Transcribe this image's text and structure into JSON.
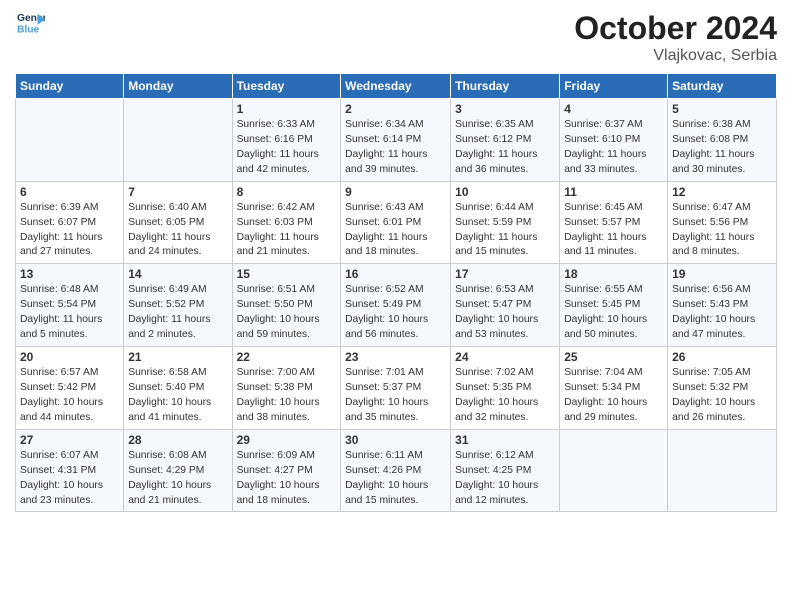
{
  "header": {
    "logo_line1": "General",
    "logo_line2": "Blue",
    "month_title": "October 2024",
    "location": "Vlajkovac, Serbia"
  },
  "weekdays": [
    "Sunday",
    "Monday",
    "Tuesday",
    "Wednesday",
    "Thursday",
    "Friday",
    "Saturday"
  ],
  "weeks": [
    [
      {
        "day": "",
        "sunrise": "",
        "sunset": "",
        "daylight": ""
      },
      {
        "day": "",
        "sunrise": "",
        "sunset": "",
        "daylight": ""
      },
      {
        "day": "1",
        "sunrise": "Sunrise: 6:33 AM",
        "sunset": "Sunset: 6:16 PM",
        "daylight": "Daylight: 11 hours and 42 minutes."
      },
      {
        "day": "2",
        "sunrise": "Sunrise: 6:34 AM",
        "sunset": "Sunset: 6:14 PM",
        "daylight": "Daylight: 11 hours and 39 minutes."
      },
      {
        "day": "3",
        "sunrise": "Sunrise: 6:35 AM",
        "sunset": "Sunset: 6:12 PM",
        "daylight": "Daylight: 11 hours and 36 minutes."
      },
      {
        "day": "4",
        "sunrise": "Sunrise: 6:37 AM",
        "sunset": "Sunset: 6:10 PM",
        "daylight": "Daylight: 11 hours and 33 minutes."
      },
      {
        "day": "5",
        "sunrise": "Sunrise: 6:38 AM",
        "sunset": "Sunset: 6:08 PM",
        "daylight": "Daylight: 11 hours and 30 minutes."
      }
    ],
    [
      {
        "day": "6",
        "sunrise": "Sunrise: 6:39 AM",
        "sunset": "Sunset: 6:07 PM",
        "daylight": "Daylight: 11 hours and 27 minutes."
      },
      {
        "day": "7",
        "sunrise": "Sunrise: 6:40 AM",
        "sunset": "Sunset: 6:05 PM",
        "daylight": "Daylight: 11 hours and 24 minutes."
      },
      {
        "day": "8",
        "sunrise": "Sunrise: 6:42 AM",
        "sunset": "Sunset: 6:03 PM",
        "daylight": "Daylight: 11 hours and 21 minutes."
      },
      {
        "day": "9",
        "sunrise": "Sunrise: 6:43 AM",
        "sunset": "Sunset: 6:01 PM",
        "daylight": "Daylight: 11 hours and 18 minutes."
      },
      {
        "day": "10",
        "sunrise": "Sunrise: 6:44 AM",
        "sunset": "Sunset: 5:59 PM",
        "daylight": "Daylight: 11 hours and 15 minutes."
      },
      {
        "day": "11",
        "sunrise": "Sunrise: 6:45 AM",
        "sunset": "Sunset: 5:57 PM",
        "daylight": "Daylight: 11 hours and 11 minutes."
      },
      {
        "day": "12",
        "sunrise": "Sunrise: 6:47 AM",
        "sunset": "Sunset: 5:56 PM",
        "daylight": "Daylight: 11 hours and 8 minutes."
      }
    ],
    [
      {
        "day": "13",
        "sunrise": "Sunrise: 6:48 AM",
        "sunset": "Sunset: 5:54 PM",
        "daylight": "Daylight: 11 hours and 5 minutes."
      },
      {
        "day": "14",
        "sunrise": "Sunrise: 6:49 AM",
        "sunset": "Sunset: 5:52 PM",
        "daylight": "Daylight: 11 hours and 2 minutes."
      },
      {
        "day": "15",
        "sunrise": "Sunrise: 6:51 AM",
        "sunset": "Sunset: 5:50 PM",
        "daylight": "Daylight: 10 hours and 59 minutes."
      },
      {
        "day": "16",
        "sunrise": "Sunrise: 6:52 AM",
        "sunset": "Sunset: 5:49 PM",
        "daylight": "Daylight: 10 hours and 56 minutes."
      },
      {
        "day": "17",
        "sunrise": "Sunrise: 6:53 AM",
        "sunset": "Sunset: 5:47 PM",
        "daylight": "Daylight: 10 hours and 53 minutes."
      },
      {
        "day": "18",
        "sunrise": "Sunrise: 6:55 AM",
        "sunset": "Sunset: 5:45 PM",
        "daylight": "Daylight: 10 hours and 50 minutes."
      },
      {
        "day": "19",
        "sunrise": "Sunrise: 6:56 AM",
        "sunset": "Sunset: 5:43 PM",
        "daylight": "Daylight: 10 hours and 47 minutes."
      }
    ],
    [
      {
        "day": "20",
        "sunrise": "Sunrise: 6:57 AM",
        "sunset": "Sunset: 5:42 PM",
        "daylight": "Daylight: 10 hours and 44 minutes."
      },
      {
        "day": "21",
        "sunrise": "Sunrise: 6:58 AM",
        "sunset": "Sunset: 5:40 PM",
        "daylight": "Daylight: 10 hours and 41 minutes."
      },
      {
        "day": "22",
        "sunrise": "Sunrise: 7:00 AM",
        "sunset": "Sunset: 5:38 PM",
        "daylight": "Daylight: 10 hours and 38 minutes."
      },
      {
        "day": "23",
        "sunrise": "Sunrise: 7:01 AM",
        "sunset": "Sunset: 5:37 PM",
        "daylight": "Daylight: 10 hours and 35 minutes."
      },
      {
        "day": "24",
        "sunrise": "Sunrise: 7:02 AM",
        "sunset": "Sunset: 5:35 PM",
        "daylight": "Daylight: 10 hours and 32 minutes."
      },
      {
        "day": "25",
        "sunrise": "Sunrise: 7:04 AM",
        "sunset": "Sunset: 5:34 PM",
        "daylight": "Daylight: 10 hours and 29 minutes."
      },
      {
        "day": "26",
        "sunrise": "Sunrise: 7:05 AM",
        "sunset": "Sunset: 5:32 PM",
        "daylight": "Daylight: 10 hours and 26 minutes."
      }
    ],
    [
      {
        "day": "27",
        "sunrise": "Sunrise: 6:07 AM",
        "sunset": "Sunset: 4:31 PM",
        "daylight": "Daylight: 10 hours and 23 minutes."
      },
      {
        "day": "28",
        "sunrise": "Sunrise: 6:08 AM",
        "sunset": "Sunset: 4:29 PM",
        "daylight": "Daylight: 10 hours and 21 minutes."
      },
      {
        "day": "29",
        "sunrise": "Sunrise: 6:09 AM",
        "sunset": "Sunset: 4:27 PM",
        "daylight": "Daylight: 10 hours and 18 minutes."
      },
      {
        "day": "30",
        "sunrise": "Sunrise: 6:11 AM",
        "sunset": "Sunset: 4:26 PM",
        "daylight": "Daylight: 10 hours and 15 minutes."
      },
      {
        "day": "31",
        "sunrise": "Sunrise: 6:12 AM",
        "sunset": "Sunset: 4:25 PM",
        "daylight": "Daylight: 10 hours and 12 minutes."
      },
      {
        "day": "",
        "sunrise": "",
        "sunset": "",
        "daylight": ""
      },
      {
        "day": "",
        "sunrise": "",
        "sunset": "",
        "daylight": ""
      }
    ]
  ]
}
